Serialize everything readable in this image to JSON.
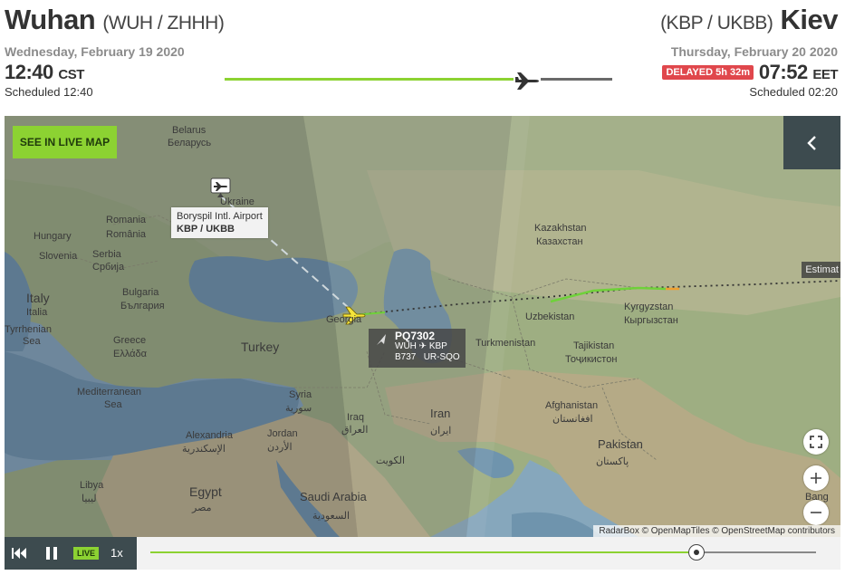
{
  "origin": {
    "city": "Wuhan",
    "codes": "(WUH / ZHHH)",
    "date": "Wednesday, February 19 2020",
    "time": "12:40",
    "tz": "CST",
    "scheduled": "Scheduled 12:40"
  },
  "destination": {
    "city": "Kiev",
    "codes": "(KBP / UKBB)",
    "date": "Thursday, February 20 2020",
    "delay_badge": "DELAYED 5h 32m",
    "time": "07:52",
    "tz": "EET",
    "scheduled": "Scheduled 02:20"
  },
  "progress": {
    "fraction": 0.78,
    "done_color": "#8cd232",
    "rest_color": "#6a6a6a"
  },
  "map": {
    "live_button": "SEE IN LIVE MAP",
    "collapse_icon": "chevron-left-icon",
    "estimate_label": "Estimat",
    "airport_popup": {
      "name": "Boryspil Intl. Airport",
      "codes": "KBP / UKBB"
    },
    "flight": {
      "number": "PQ7302",
      "route": "WUH ✈ KBP",
      "aircraft": "B737",
      "registration": "UR-SQO"
    },
    "attribution": "RadarBox © OpenMapTiles © OpenStreetMap contributors",
    "labels": {
      "belarus": "Belarus",
      "belarus_local": "Беларусь",
      "ukraine": "Ukraine",
      "kazakhstan": "Kazakhstan",
      "kazakhstan_local": "Казахстан",
      "hungary": "Hungary",
      "romania": "Romania",
      "romania_local": "România",
      "slovenia": "Slovenia",
      "serbia": "Serbia",
      "serbia_local": "Србија",
      "italy": "Italy",
      "italy_local": "Italia",
      "bulgaria": "Bulgaria",
      "bulgaria_local": "България",
      "georgia": "Georgia",
      "uzbekistan": "Uzbekistan",
      "kyrgyzstan": "Kyrgyzstan",
      "kyrgyzstan_local": "Кыргызстан",
      "tyrrhenian": "Tyrrhenian",
      "tyrrhenian_2": "Sea",
      "greece": "Greece",
      "greece_local": "Ελλάδα",
      "turkey": "Turkey",
      "turkmenistan": "Turkmenistan",
      "tajikistan": "Tajikistan",
      "tajikistan_local": "Тоҷикистон",
      "mediterranean": "Mediterranean",
      "mediterranean_2": "Sea",
      "syria": "Syria",
      "syria_local": "سورية",
      "iraq": "Iraq",
      "iraq_local": "العراق",
      "iran": "Iran",
      "iran_local": "ایران",
      "afghanistan": "Afghanistan",
      "afghanistan_local": "افغانستان",
      "jordan": "Jordan",
      "jordan_local": "الأردن",
      "kuwait": "الكويت",
      "alexandria": "Alexandria",
      "alexandria_local": "الإسكندرية",
      "pakistan": "Pakistan",
      "pakistan_local": "پاکستان",
      "libya": "Libya",
      "libya_local": "ليبيا",
      "egypt": "Egypt",
      "egypt_local": "مصر",
      "saudi": "Saudi Arabia",
      "saudi_local": "السعودية",
      "bangladesh": "Bang"
    }
  },
  "playback": {
    "live_badge": "LIVE",
    "speed": "1x",
    "fraction": 0.82
  }
}
